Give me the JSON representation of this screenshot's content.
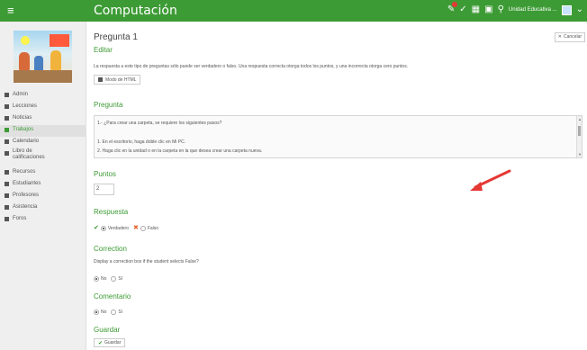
{
  "app": {
    "title": "Computación"
  },
  "topbar": {
    "school": "Unidad Educativa ..."
  },
  "sidebar": {
    "items": [
      {
        "label": "Admin",
        "icon": "gear-icon"
      },
      {
        "label": "Lecciones",
        "icon": "lessons-icon"
      },
      {
        "label": "Noticias",
        "icon": "news-icon"
      },
      {
        "label": "Trabajos",
        "icon": "assignments-icon",
        "active": true
      },
      {
        "label": "Calendario",
        "icon": "calendar-icon"
      },
      {
        "label_1": "Libro de",
        "label_2": "calificaciones",
        "icon": "gradebook-icon"
      },
      {
        "label": "Recursos",
        "icon": "resources-icon"
      },
      {
        "label": "Estudiantes",
        "icon": "students-icon"
      },
      {
        "label": "Profesores",
        "icon": "teachers-icon"
      },
      {
        "label": "Asistencia",
        "icon": "attendance-icon"
      },
      {
        "label": "Foros",
        "icon": "forums-icon"
      }
    ]
  },
  "page": {
    "title": "Pregunta 1",
    "subtitle": "Editar",
    "cancel_label": "Cancelar",
    "description": "La respuesta a este tipo de preguntas sólo puede ser verdadero o falso. Una respuesta correcta otorga todos los puntos, y una incorrecta otorga cero puntos.",
    "html_mode_label": "Modo de HTML"
  },
  "question": {
    "heading": "Pregunta",
    "lines": [
      "1.- ¿Para crear una carpeta, se requiere los siguientes pasos?",
      "",
      "1.   En el escritorio, haga doble clic en Mi PC.",
      "2.   Haga clic en la unidad o en la carpeta en la que desea crear una carpeta nueva."
    ]
  },
  "points": {
    "heading": "Puntos",
    "value": "2"
  },
  "answer": {
    "heading": "Respuesta",
    "true_label": "Verdadero",
    "false_label": "Falso",
    "selected": "Verdadero"
  },
  "correction": {
    "heading": "Correction",
    "description": "Display a correction box if the student selects False?",
    "no_label": "No",
    "yes_label": "Sí",
    "selected": "No"
  },
  "comment": {
    "heading": "Comentario",
    "no_label": "No",
    "yes_label": "Sí",
    "selected": "No"
  },
  "save": {
    "heading": "Guardar",
    "button_label": "Guardar"
  },
  "colors": {
    "accent": "#3d9b35",
    "arrow": "#e53935"
  }
}
